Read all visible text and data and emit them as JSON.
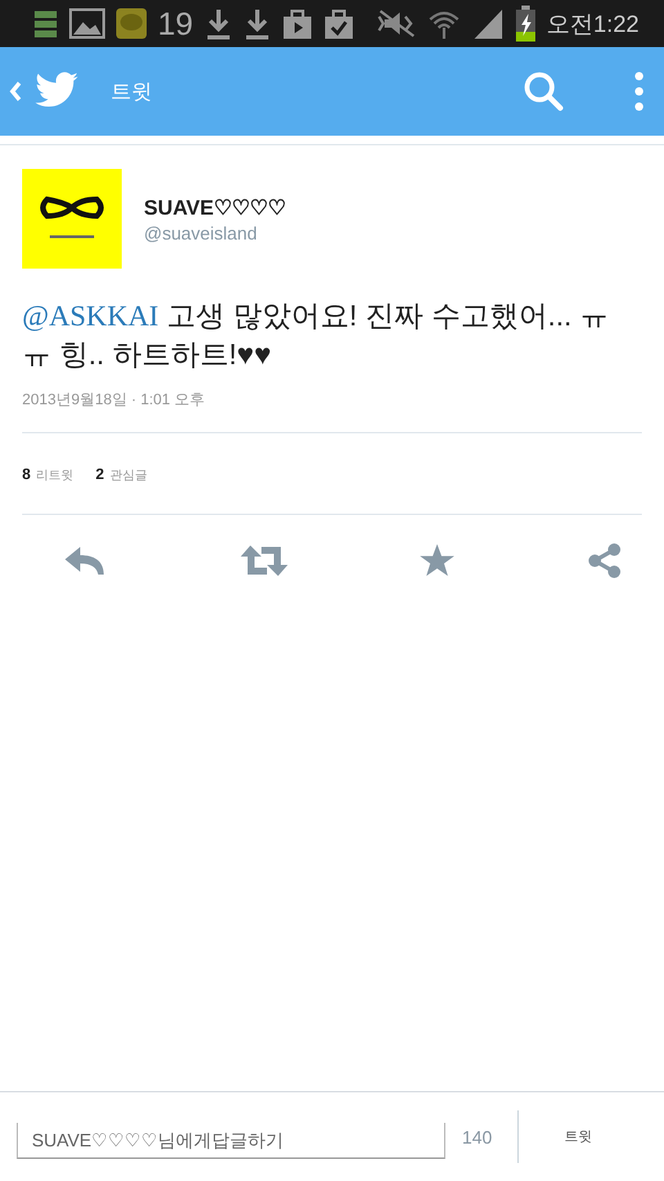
{
  "status_bar": {
    "notification_count": "19",
    "time": "오전1:22"
  },
  "app_bar": {
    "title": "트윗"
  },
  "tweet": {
    "display_name": "SUAVE♡♡♡♡",
    "handle": "@suaveisland",
    "mention": "@ASKKAI",
    "text": " 고생 많았어요! 진짜 수고했어... ㅠㅠ 힝.. 하트하트!♥♥",
    "timestamp": "2013년9월18일 · 1:01 오후",
    "stats": [
      {
        "count": "8",
        "label": "리트윗"
      },
      {
        "count": "2",
        "label": "관심글"
      }
    ]
  },
  "actions": [
    {
      "kind": "reply"
    },
    {
      "kind": "retweet"
    },
    {
      "kind": "favorite"
    },
    {
      "kind": "share"
    }
  ],
  "composer": {
    "placeholder": "SUAVE♡♡♡♡님에게답글하기",
    "counter": "140",
    "button": "트윗"
  }
}
